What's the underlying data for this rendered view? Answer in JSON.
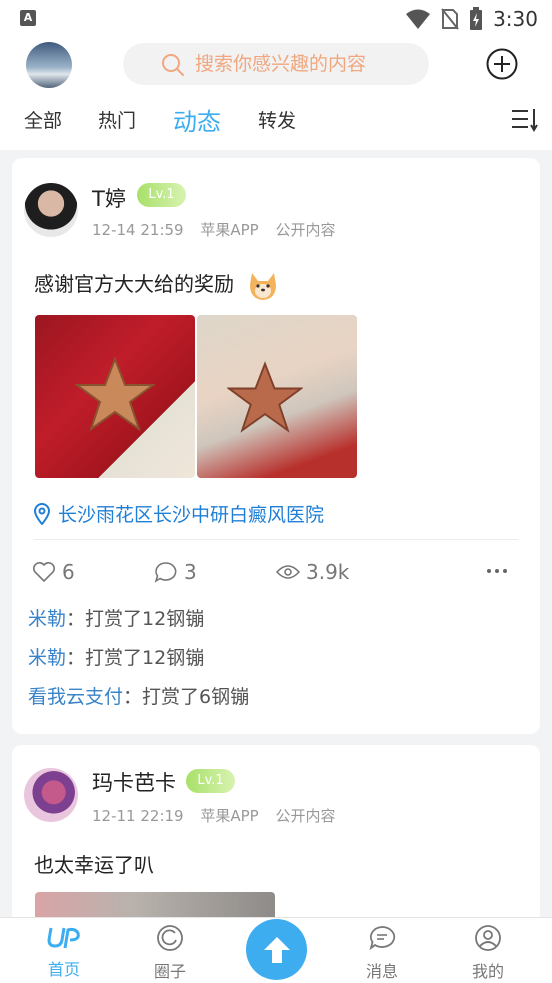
{
  "status_bar": {
    "app_badge": "A",
    "time": "3:30"
  },
  "header": {
    "search_placeholder": "搜索你感兴趣的内容"
  },
  "tabs": [
    {
      "label": "全部"
    },
    {
      "label": "热门"
    },
    {
      "label": "动态",
      "active": true
    },
    {
      "label": "转发"
    }
  ],
  "posts": [
    {
      "username": "T婷",
      "level": "Lv.1",
      "date": "12-14 21:59",
      "source": "苹果APP",
      "visibility": "公开内容",
      "text": "感谢官方大大给的奖励",
      "location": "长沙雨花区长沙中研白癜风医院",
      "likes": "6",
      "comments": "3",
      "views": "3.9k",
      "rewards": [
        {
          "who": "米勒",
          "text": "：打赏了12钢镚"
        },
        {
          "who": "米勒",
          "text": "：打赏了12钢镚"
        },
        {
          "who": "看我云支付",
          "text": "：打赏了6钢镚"
        }
      ]
    },
    {
      "username": "玛卡芭卡",
      "level": "Lv.1",
      "date": "12-11 22:19",
      "source": "苹果APP",
      "visibility": "公开内容",
      "text": "也太幸运了叭"
    }
  ],
  "bottom_nav": [
    {
      "label": "首页",
      "active": true
    },
    {
      "label": "圈子"
    },
    {
      "label": "消息"
    },
    {
      "label": "我的"
    }
  ],
  "colors": {
    "accent": "#3eadf0",
    "link": "#1f7fd6",
    "search_text": "#f0a77f",
    "level_badge": "#a8e06a"
  }
}
